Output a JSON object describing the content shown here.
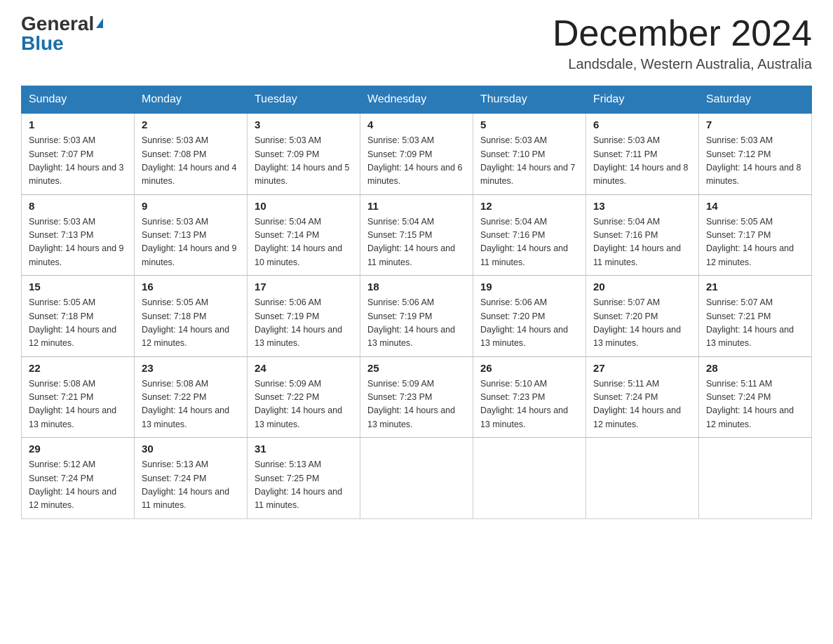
{
  "header": {
    "logo_general": "General",
    "logo_blue": "Blue",
    "month_title": "December 2024",
    "location": "Landsdale, Western Australia, Australia"
  },
  "weekdays": [
    "Sunday",
    "Monday",
    "Tuesday",
    "Wednesday",
    "Thursday",
    "Friday",
    "Saturday"
  ],
  "weeks": [
    [
      {
        "day": "1",
        "sunrise": "5:03 AM",
        "sunset": "7:07 PM",
        "daylight": "14 hours and 3 minutes."
      },
      {
        "day": "2",
        "sunrise": "5:03 AM",
        "sunset": "7:08 PM",
        "daylight": "14 hours and 4 minutes."
      },
      {
        "day": "3",
        "sunrise": "5:03 AM",
        "sunset": "7:09 PM",
        "daylight": "14 hours and 5 minutes."
      },
      {
        "day": "4",
        "sunrise": "5:03 AM",
        "sunset": "7:09 PM",
        "daylight": "14 hours and 6 minutes."
      },
      {
        "day": "5",
        "sunrise": "5:03 AM",
        "sunset": "7:10 PM",
        "daylight": "14 hours and 7 minutes."
      },
      {
        "day": "6",
        "sunrise": "5:03 AM",
        "sunset": "7:11 PM",
        "daylight": "14 hours and 8 minutes."
      },
      {
        "day": "7",
        "sunrise": "5:03 AM",
        "sunset": "7:12 PM",
        "daylight": "14 hours and 8 minutes."
      }
    ],
    [
      {
        "day": "8",
        "sunrise": "5:03 AM",
        "sunset": "7:13 PM",
        "daylight": "14 hours and 9 minutes."
      },
      {
        "day": "9",
        "sunrise": "5:03 AM",
        "sunset": "7:13 PM",
        "daylight": "14 hours and 9 minutes."
      },
      {
        "day": "10",
        "sunrise": "5:04 AM",
        "sunset": "7:14 PM",
        "daylight": "14 hours and 10 minutes."
      },
      {
        "day": "11",
        "sunrise": "5:04 AM",
        "sunset": "7:15 PM",
        "daylight": "14 hours and 11 minutes."
      },
      {
        "day": "12",
        "sunrise": "5:04 AM",
        "sunset": "7:16 PM",
        "daylight": "14 hours and 11 minutes."
      },
      {
        "day": "13",
        "sunrise": "5:04 AM",
        "sunset": "7:16 PM",
        "daylight": "14 hours and 11 minutes."
      },
      {
        "day": "14",
        "sunrise": "5:05 AM",
        "sunset": "7:17 PM",
        "daylight": "14 hours and 12 minutes."
      }
    ],
    [
      {
        "day": "15",
        "sunrise": "5:05 AM",
        "sunset": "7:18 PM",
        "daylight": "14 hours and 12 minutes."
      },
      {
        "day": "16",
        "sunrise": "5:05 AM",
        "sunset": "7:18 PM",
        "daylight": "14 hours and 12 minutes."
      },
      {
        "day": "17",
        "sunrise": "5:06 AM",
        "sunset": "7:19 PM",
        "daylight": "14 hours and 13 minutes."
      },
      {
        "day": "18",
        "sunrise": "5:06 AM",
        "sunset": "7:19 PM",
        "daylight": "14 hours and 13 minutes."
      },
      {
        "day": "19",
        "sunrise": "5:06 AM",
        "sunset": "7:20 PM",
        "daylight": "14 hours and 13 minutes."
      },
      {
        "day": "20",
        "sunrise": "5:07 AM",
        "sunset": "7:20 PM",
        "daylight": "14 hours and 13 minutes."
      },
      {
        "day": "21",
        "sunrise": "5:07 AM",
        "sunset": "7:21 PM",
        "daylight": "14 hours and 13 minutes."
      }
    ],
    [
      {
        "day": "22",
        "sunrise": "5:08 AM",
        "sunset": "7:21 PM",
        "daylight": "14 hours and 13 minutes."
      },
      {
        "day": "23",
        "sunrise": "5:08 AM",
        "sunset": "7:22 PM",
        "daylight": "14 hours and 13 minutes."
      },
      {
        "day": "24",
        "sunrise": "5:09 AM",
        "sunset": "7:22 PM",
        "daylight": "14 hours and 13 minutes."
      },
      {
        "day": "25",
        "sunrise": "5:09 AM",
        "sunset": "7:23 PM",
        "daylight": "14 hours and 13 minutes."
      },
      {
        "day": "26",
        "sunrise": "5:10 AM",
        "sunset": "7:23 PM",
        "daylight": "14 hours and 13 minutes."
      },
      {
        "day": "27",
        "sunrise": "5:11 AM",
        "sunset": "7:24 PM",
        "daylight": "14 hours and 12 minutes."
      },
      {
        "day": "28",
        "sunrise": "5:11 AM",
        "sunset": "7:24 PM",
        "daylight": "14 hours and 12 minutes."
      }
    ],
    [
      {
        "day": "29",
        "sunrise": "5:12 AM",
        "sunset": "7:24 PM",
        "daylight": "14 hours and 12 minutes."
      },
      {
        "day": "30",
        "sunrise": "5:13 AM",
        "sunset": "7:24 PM",
        "daylight": "14 hours and 11 minutes."
      },
      {
        "day": "31",
        "sunrise": "5:13 AM",
        "sunset": "7:25 PM",
        "daylight": "14 hours and 11 minutes."
      },
      null,
      null,
      null,
      null
    ]
  ]
}
